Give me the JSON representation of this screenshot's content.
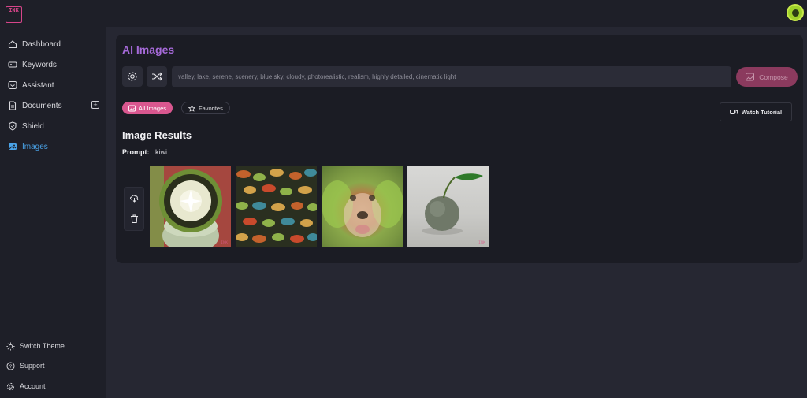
{
  "app": {
    "logo_text": "INK"
  },
  "sidebar": {
    "items": [
      {
        "label": "Dashboard",
        "icon": "home-icon"
      },
      {
        "label": "Keywords",
        "icon": "key-icon"
      },
      {
        "label": "Assistant",
        "icon": "chat-icon"
      },
      {
        "label": "Documents",
        "icon": "document-icon"
      },
      {
        "label": "Shield",
        "icon": "shield-icon"
      },
      {
        "label": "Images",
        "icon": "images-icon",
        "active": true
      }
    ],
    "bottom": [
      {
        "label": "Switch Theme",
        "icon": "sun-icon"
      },
      {
        "label": "Support",
        "icon": "help-icon"
      },
      {
        "label": "Account",
        "icon": "gear-icon"
      }
    ]
  },
  "main": {
    "title": "AI Images",
    "prompt_placeholder": "valley, lake, serene, scenery, blue sky, cloudy, photorealistic, realism, highly detailed, cinematic light",
    "compose_label": "Compose",
    "filters": {
      "all_label": "All Images",
      "favorites_label": "Favorites"
    },
    "tutorial_label": "Watch Tutorial",
    "results_title": "Image Results",
    "prompt_label": "Prompt:",
    "prompt_value": "kiwi",
    "images": [
      {
        "subject": "kiwi-slice-cup-image"
      },
      {
        "subject": "abstract-kiwi-pattern-image"
      },
      {
        "subject": "blurry-dog-face-kiwi-image"
      },
      {
        "subject": "kiwi-fruit-leaf-image"
      }
    ],
    "watermark": "INK"
  },
  "colors": {
    "accent": "#d9578f",
    "title": "#a66ad9",
    "active_nav": "#4aa3e8",
    "compose": "#8b3a5e"
  }
}
